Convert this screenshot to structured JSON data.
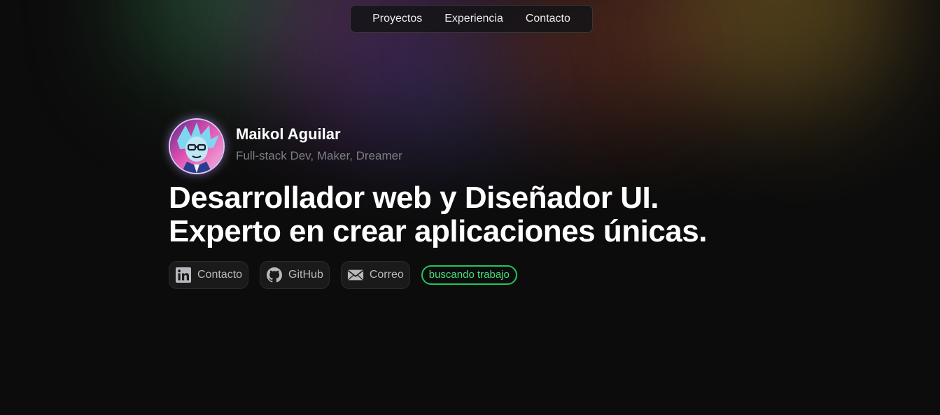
{
  "nav": {
    "items": [
      {
        "label": "Proyectos"
      },
      {
        "label": "Experiencia"
      },
      {
        "label": "Contacto"
      }
    ]
  },
  "profile": {
    "name": "Maikol Aguilar",
    "tagline": "Full-stack Dev, Maker, Dreamer",
    "avatar_alt": "avatar-illustration"
  },
  "hero": {
    "headline_line1": "Desarrollador web y Diseñador UI.",
    "headline_line2": "Experto en crear aplicaciones únicas."
  },
  "links": [
    {
      "label": "Contacto",
      "icon": "linkedin-icon"
    },
    {
      "label": "GitHub",
      "icon": "github-icon"
    },
    {
      "label": "Correo",
      "icon": "mail-icon"
    }
  ],
  "status_badge": "buscando trabajo",
  "colors": {
    "background": "#0c0c0c",
    "badge": "#22c55e",
    "badge_text": "#4ade80",
    "muted_text": "#7d7d85",
    "chip_bg": "#1a1a1a"
  }
}
